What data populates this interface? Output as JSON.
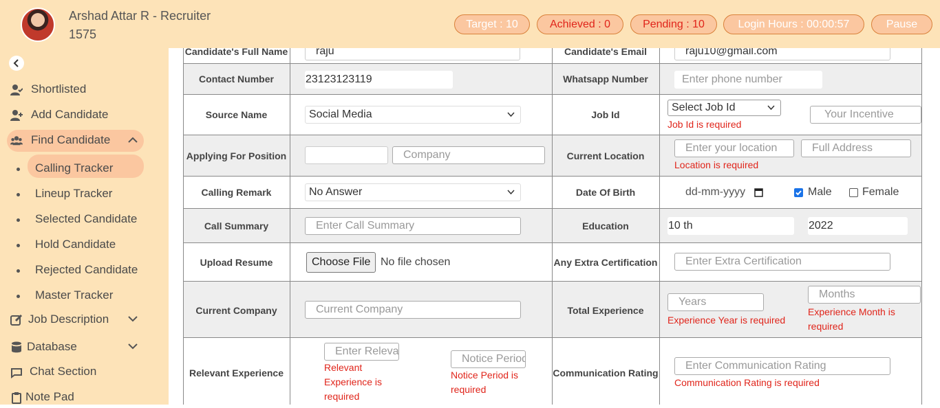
{
  "header": {
    "user_name": "Arshad Attar R - Recruiter",
    "user_id": "1575",
    "target": "Target : 10",
    "achieved": "Achieved : 0",
    "pending": "Pending : 10",
    "login_hours": "Login Hours : 00:00:57",
    "pause": "Pause"
  },
  "sidebar": {
    "items": [
      {
        "label": "Shortlisted",
        "icon": "user-check-icon"
      },
      {
        "label": "Add Candidate",
        "icon": "user-plus-icon"
      },
      {
        "label": "Find Candidate",
        "icon": "users-icon"
      },
      {
        "label": "Job Description",
        "icon": "edit-icon"
      },
      {
        "label": "Database",
        "icon": "database-icon"
      },
      {
        "label": "Chat Section",
        "icon": "chat-icon"
      },
      {
        "label": "Note Pad",
        "icon": "clipboard-icon"
      }
    ],
    "sub_items": [
      "Calling Tracker",
      "Lineup Tracker",
      "Selected Candidate",
      "Hold Candidate",
      "Rejected Candidate",
      "Master Tracker"
    ]
  },
  "form": {
    "top_left_label": "Candidate's Full Name",
    "top_left_value": "raju",
    "top_right_label": "Candidate's Email",
    "top_right_value": "raju10@gmail.com",
    "contact_label": "Contact Number",
    "contact_value": "23123123119",
    "whatsapp_label": "Whatsapp Number",
    "whatsapp_placeholder": "Enter phone number",
    "source_label": "Source Name",
    "source_value": "Social Media",
    "jobid_label": "Job Id",
    "jobid_value": "Select Job Id",
    "jobid_error": "Job Id is required",
    "incentive_placeholder": "Your Incentive",
    "position_label": "Applying For Position",
    "company_placeholder": "Company",
    "location_label": "Current Location",
    "location_placeholder": "Enter your location",
    "address_placeholder": "Full Address",
    "location_error": "Location is required",
    "remark_label": "Calling Remark",
    "remark_value": "No Answer",
    "dob_label": "Date Of Birth",
    "dob_placeholder": "dd-mm-yyyy",
    "male_label": "Male",
    "female_label": "Female",
    "summary_label": "Call Summary",
    "summary_placeholder": "Enter Call Summary",
    "education_label": "Education",
    "education_value": "10 th",
    "year_value": "2022",
    "resume_label": "Upload Resume",
    "choose_file": "Choose File",
    "no_file": "No file chosen",
    "cert_label": "Any Extra Certification",
    "cert_placeholder": "Enter Extra Certification",
    "company_label": "Current Company",
    "current_company_placeholder": "Current Company",
    "experience_label": "Total Experience",
    "years_placeholder": "Years",
    "months_placeholder": "Months",
    "exp_year_error": "Experience Year is required",
    "exp_month_error_1": "Experience Month is",
    "exp_month_error_2": "required",
    "relevant_label": "Relevant Experience",
    "relevant_placeholder": "Enter Relevant",
    "relevant_error_1": "Relevant",
    "relevant_error_2": "Experience is",
    "relevant_error_3": "required",
    "notice_placeholder": "Notice Period",
    "notice_error_1": "Notice Period is",
    "notice_error_2": "required",
    "comm_label": "Communication Rating",
    "comm_placeholder": "Enter Communication Rating",
    "comm_error": "Communication Rating is required"
  }
}
